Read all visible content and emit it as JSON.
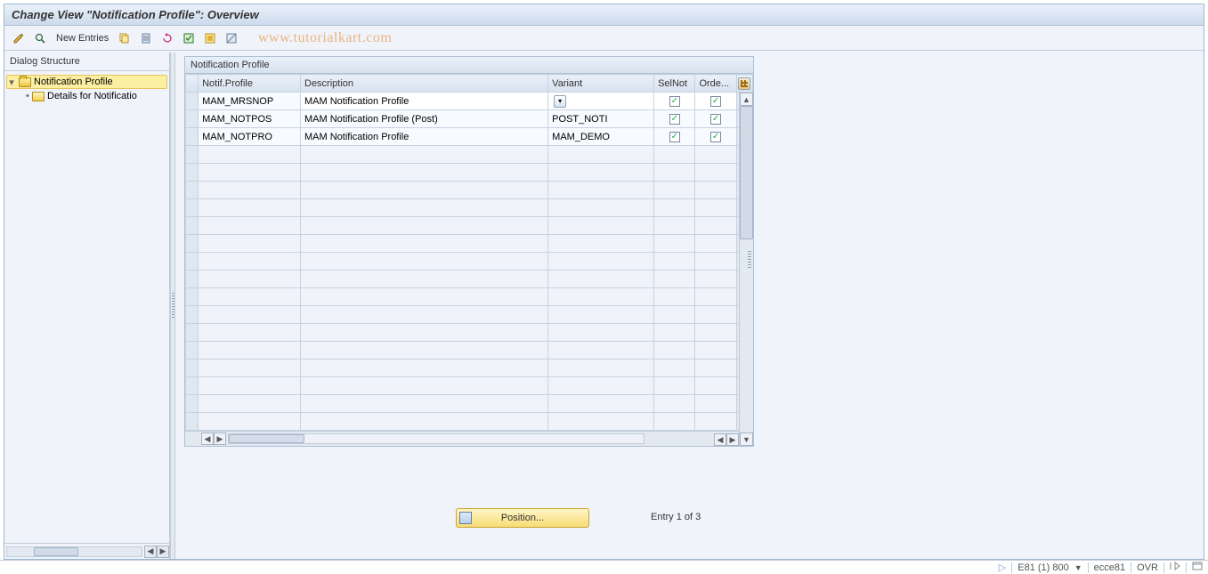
{
  "title": "Change View \"Notification Profile\": Overview",
  "toolbar": {
    "new_entries": "New Entries"
  },
  "watermark": "www.tutorialkart.com",
  "sidebar": {
    "title": "Dialog Structure",
    "items": [
      {
        "label": "Notification Profile",
        "selected": true,
        "open": true
      },
      {
        "label": "Details for Notificatio",
        "selected": false,
        "open": false
      }
    ]
  },
  "group_title": "Notification Profile",
  "columns": {
    "c1": "Notif.Profile",
    "c2": "Description",
    "c3": "Variant",
    "c4": "SelNot",
    "c5": "Orde..."
  },
  "rows": [
    {
      "profile": "MAM_MRSNOP",
      "desc": "MAM Notification Profile",
      "variant": "",
      "selnot": true,
      "orde": true,
      "editing": true
    },
    {
      "profile": "MAM_NOTPOS",
      "desc": "MAM Notification Profile (Post)",
      "variant": "POST_NOTI",
      "selnot": true,
      "orde": true,
      "editing": false
    },
    {
      "profile": "MAM_NOTPRO",
      "desc": "MAM Notification Profile",
      "variant": "MAM_DEMO",
      "selnot": true,
      "orde": true,
      "editing": false
    }
  ],
  "empty_rows": 16,
  "position_label": "Position...",
  "entry_text": "Entry 1 of 3",
  "status": {
    "system": "E81 (1) 800",
    "server": "ecce81",
    "mode": "OVR"
  }
}
